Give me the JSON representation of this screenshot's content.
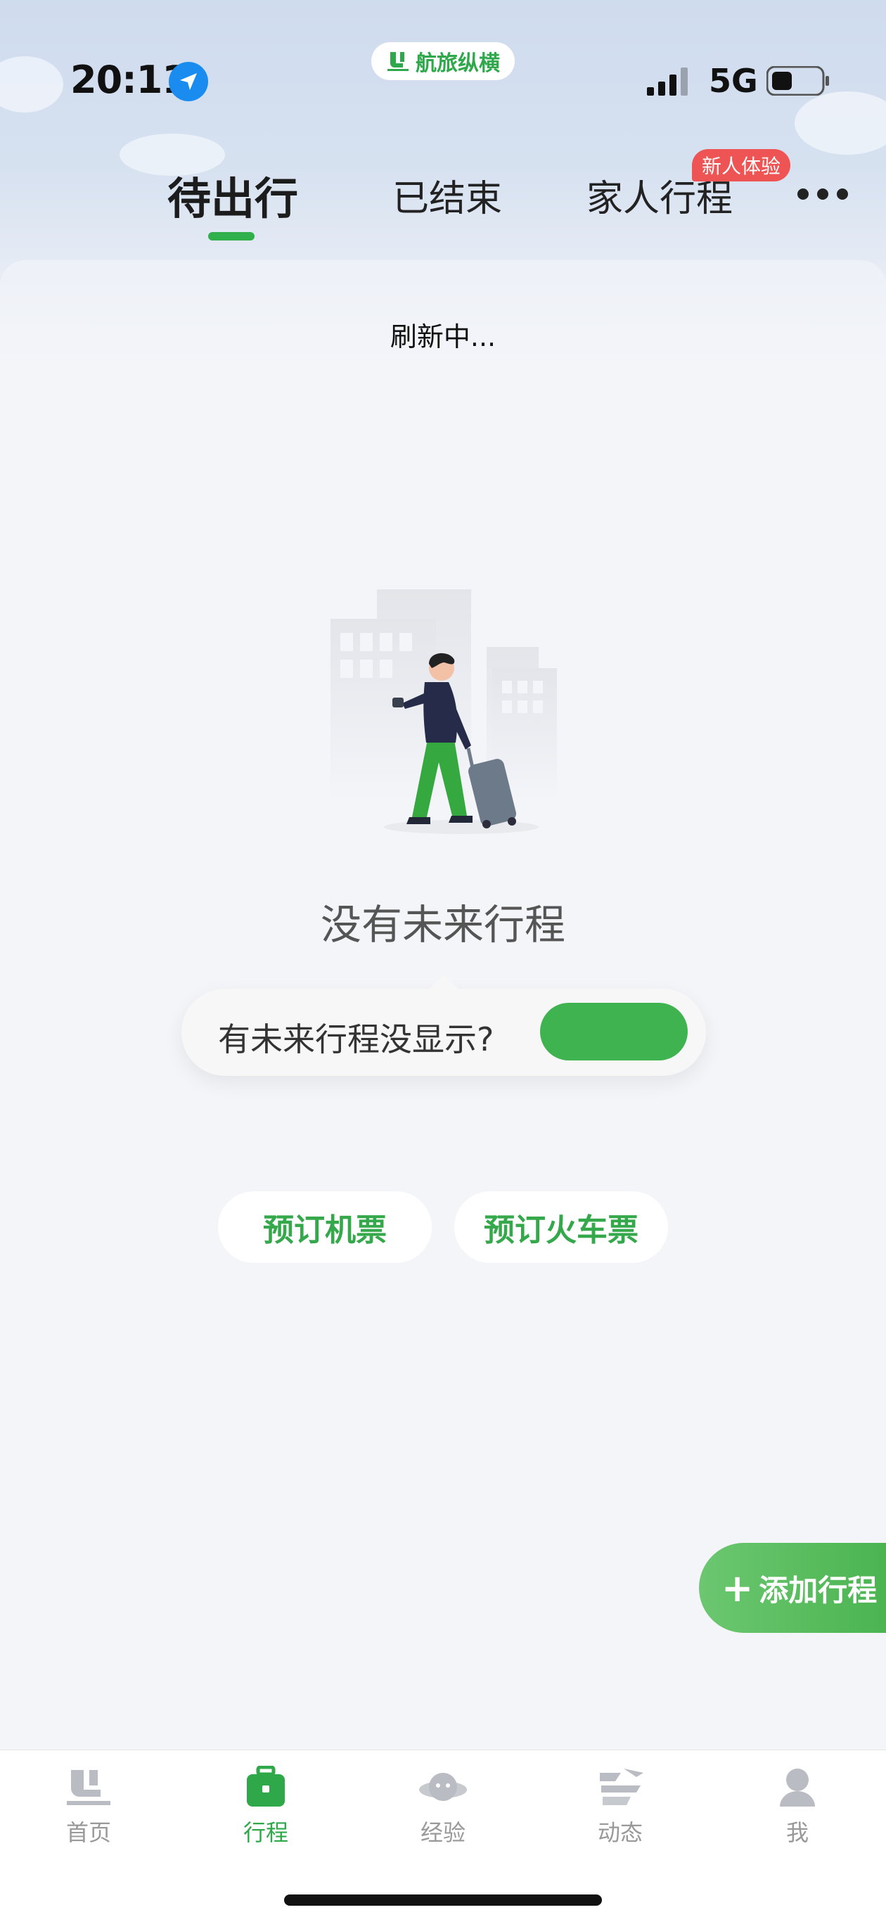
{
  "status_bar": {
    "time": "20:11",
    "network": "5G",
    "app_name": "航旅纵横"
  },
  "tabs": [
    {
      "label": "待出行",
      "active": true
    },
    {
      "label": "已结束",
      "active": false
    },
    {
      "label": "家人行程",
      "active": false,
      "badge": "新人体验"
    }
  ],
  "content": {
    "refresh_text": "刷新中...",
    "empty_title": "没有未来行程",
    "tip_text": "有未来行程没显示?",
    "book_flight": "预订机票",
    "book_train": "预订火车票",
    "add_trip": "添加行程"
  },
  "bottom_nav": [
    {
      "label": "首页",
      "icon": "home-logo-icon",
      "active": false
    },
    {
      "label": "行程",
      "icon": "briefcase-icon",
      "active": true
    },
    {
      "label": "经验",
      "icon": "planet-icon",
      "active": false
    },
    {
      "label": "动态",
      "icon": "plane-icon",
      "active": false
    },
    {
      "label": "我",
      "icon": "user-icon",
      "active": false
    }
  ],
  "colors": {
    "accent": "#2fb04a",
    "badge": "#ee5454",
    "location": "#1a8cf0"
  }
}
